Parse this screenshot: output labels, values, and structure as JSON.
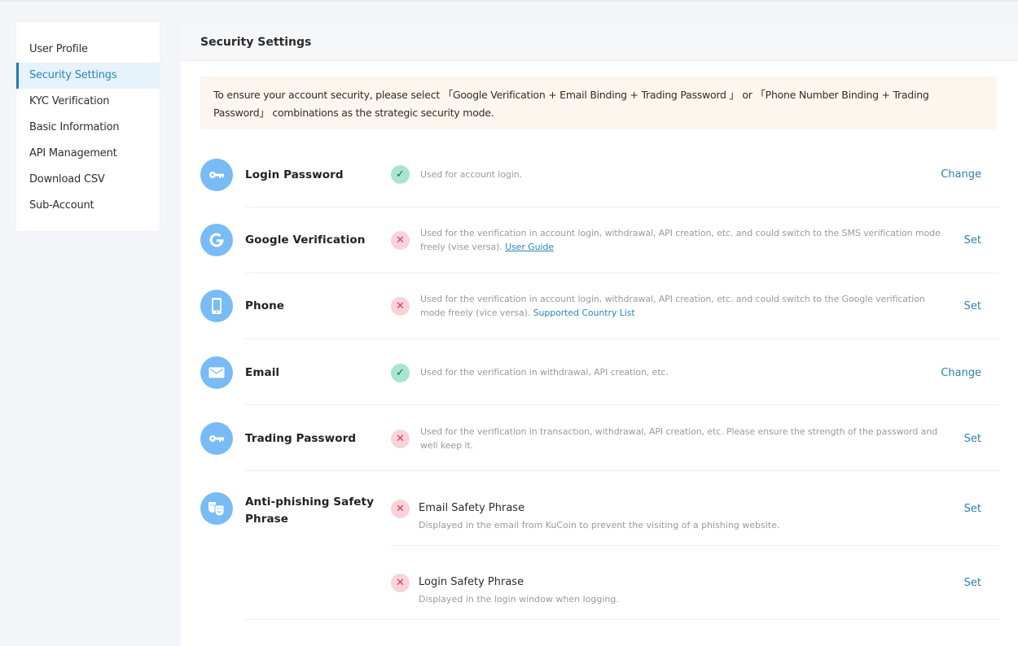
{
  "sidebar": {
    "items": [
      {
        "label": "User Profile",
        "active": false
      },
      {
        "label": "Security Settings",
        "active": true
      },
      {
        "label": "KYC Verification",
        "active": false
      },
      {
        "label": "Basic Information",
        "active": false
      },
      {
        "label": "API Management",
        "active": false
      },
      {
        "label": "Download CSV",
        "active": false
      },
      {
        "label": "Sub-Account",
        "active": false
      }
    ]
  },
  "header": {
    "title": "Security Settings"
  },
  "notice": {
    "line1": "To ensure your account security, please select 「Google Verification + Email Binding + Trading Password 」 or 「Phone Number Binding + Trading",
    "line2": "Password」 combinations as the strategic security mode."
  },
  "colors": {
    "accent": "#2a86b8",
    "icon_bg": "#78bbf5",
    "status_ok_bg": "#a7e5d0",
    "status_no_bg": "#f9d3d9",
    "notice_bg": "#fdf6ee"
  },
  "settings": [
    {
      "title": "Login Password",
      "icon": "key-icon",
      "status": "ok",
      "desc": "Used for account login.",
      "link": "",
      "action": "Change"
    },
    {
      "title": "Google Verification",
      "icon": "google-icon",
      "status": "no",
      "desc": "Used for the verification in account login, withdrawal, API creation, etc. and could switch to the SMS verification mode freely (vise versa).",
      "link": "User Guide",
      "action": "Set"
    },
    {
      "title": "Phone",
      "icon": "phone-icon",
      "status": "no",
      "desc": "Used for the verification in account login, withdrawal, API creation, etc. and could switch to the Google verification mode freely (vice versa).",
      "link": "Supported Country List",
      "action": "Set"
    },
    {
      "title": "Email",
      "icon": "mail-icon",
      "status": "ok",
      "desc": "Used for the verification in withdrawal, API creation, etc.",
      "link": "",
      "action": "Change"
    },
    {
      "title": "Trading Password",
      "icon": "key-icon",
      "status": "no",
      "desc": "Used for the verification in transaction, withdrawal, API creation, etc. Please ensure the strength of the password and well keep it.",
      "link": "",
      "action": "Set"
    }
  ],
  "anti_phishing": {
    "title": "Anti-phishing Safety Phrase",
    "items": [
      {
        "title": "Email Safety Phrase",
        "status": "no",
        "desc": "Displayed in the email from KuCoin to prevent the visiting of a phishing website.",
        "action": "Set"
      },
      {
        "title": "Login Safety Phrase",
        "status": "no",
        "desc": "Displayed in the login window when logging.",
        "action": "Set"
      }
    ]
  },
  "status_glyphs": {
    "ok": "✓",
    "no": "✕"
  }
}
